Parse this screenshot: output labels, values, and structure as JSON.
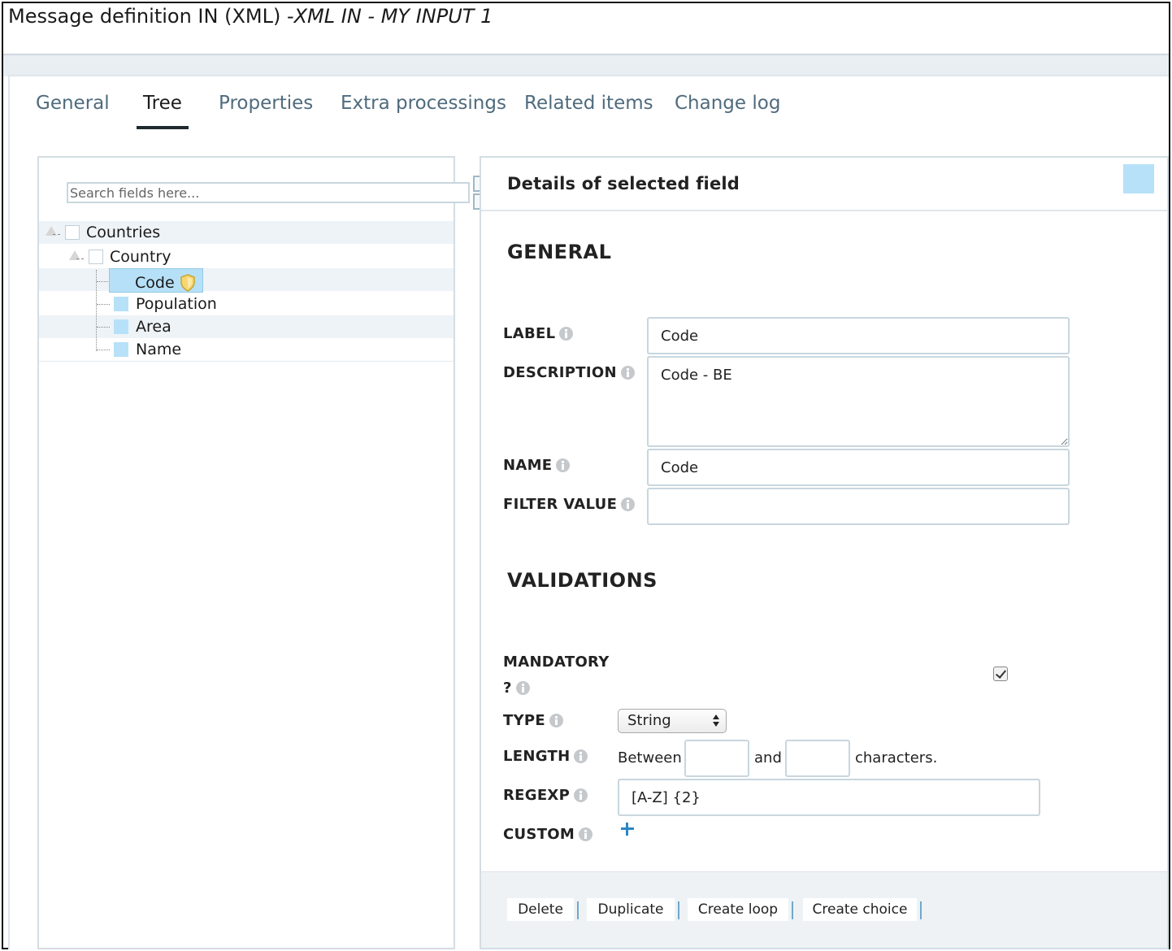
{
  "window": {
    "title_prefix": "Message definition IN (XML) -",
    "title_italic": "XML IN - MY INPUT 1"
  },
  "tabs": [
    {
      "label": "General",
      "active": false
    },
    {
      "label": "Tree",
      "active": true
    },
    {
      "label": "Properties",
      "active": false
    },
    {
      "label": "Extra processings",
      "active": false
    },
    {
      "label": "Related items",
      "active": false
    },
    {
      "label": "Change log",
      "active": false
    }
  ],
  "tree": {
    "search_placeholder": "Search fields here...",
    "nodes": [
      {
        "label": "Countries",
        "kind": "group",
        "icon": "folder-box"
      },
      {
        "label": "Country",
        "kind": "group",
        "icon": "folder-box"
      },
      {
        "label": "Code",
        "kind": "field",
        "selected": true,
        "badge": "shield-icon"
      },
      {
        "label": "Population",
        "kind": "field"
      },
      {
        "label": "Area",
        "kind": "field"
      },
      {
        "label": "Name",
        "kind": "field"
      }
    ]
  },
  "details": {
    "title": "Details of selected field",
    "general_heading": "GENERAL",
    "label_label": "LABEL",
    "label_value": "Code",
    "description_label": "DESCRIPTION",
    "description_value": "Code - BE",
    "name_label": "NAME",
    "name_value": "Code",
    "filter_label": "FILTER VALUE",
    "filter_value": "",
    "validations_heading": "VALIDATIONS",
    "mandatory_label_1": "MANDATORY",
    "mandatory_label_2": "?",
    "mandatory_checked": true,
    "type_label": "TYPE",
    "type_value": "String",
    "length_label": "LENGTH",
    "length_between": "Between",
    "length_and": "and",
    "length_suffix": "characters.",
    "length_min": "",
    "length_max": "",
    "regexp_label": "REGEXP",
    "regexp_value": "[A-Z] {2}",
    "custom_label": "CUSTOM"
  },
  "footer": {
    "delete": "Delete",
    "duplicate": "Duplicate",
    "create_loop": "Create loop",
    "create_choice": "Create choice"
  },
  "colors": {
    "selection": "#b6e0f7",
    "tab_text": "#4f6b7d",
    "accent_plus": "#2a86c6"
  }
}
